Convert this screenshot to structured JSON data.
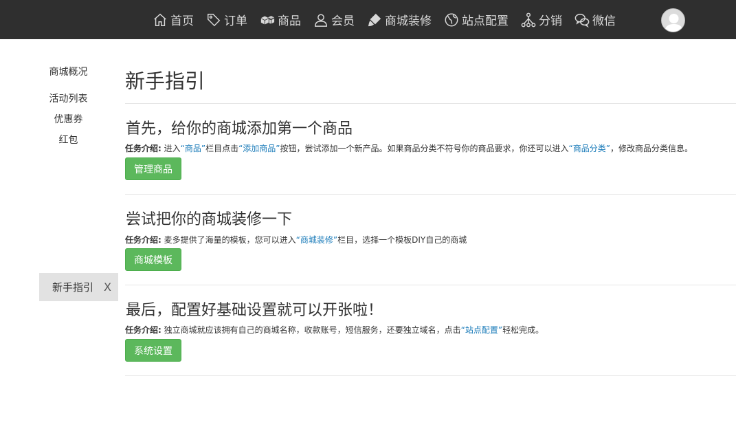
{
  "nav": {
    "items": [
      {
        "label": "首页",
        "icon": "home-icon"
      },
      {
        "label": "订单",
        "icon": "tag-icon"
      },
      {
        "label": "商品",
        "icon": "boxes-icon"
      },
      {
        "label": "会员",
        "icon": "user-icon"
      },
      {
        "label": "商城装修",
        "icon": "brush-icon"
      },
      {
        "label": "站点配置",
        "icon": "globe-icon"
      },
      {
        "label": "分销",
        "icon": "network-icon"
      },
      {
        "label": "微信",
        "icon": "wechat-icon"
      }
    ]
  },
  "sidebar": {
    "items": [
      "商城概况",
      "活动列表",
      "优惠券",
      "红包"
    ],
    "active_tab": {
      "label": "新手指引",
      "close": "X"
    }
  },
  "main": {
    "title": "新手指引",
    "steps": [
      {
        "title": "首先，给你的商城添加第一个商品",
        "desc_label": "任务介绍:",
        "desc_parts": [
          " 进入",
          "“商品”",
          "栏目点击",
          "“添加商品”",
          "按钮，尝试添加一个新产品。如果商品分类不符号你的商品要求，你还可以进入",
          "“商品分类”",
          "，修改商品分类信息。"
        ],
        "button": "管理商品"
      },
      {
        "title": "尝试把你的商城装修一下",
        "desc_label": "任务介绍:",
        "desc_parts": [
          " 麦多提供了海量的模板，您可以进入",
          "“商城装修”",
          "栏目，选择一个模板DIY自己的商城"
        ],
        "button": "商城模板"
      },
      {
        "title": "最后，配置好基础设置就可以开张啦！",
        "desc_label": "任务介绍:",
        "desc_parts": [
          " 独立商城就应该拥有自己的商城名称，收款账号，短信服务，还要独立域名，点击",
          "“站点配置”",
          "轻松完成。"
        ],
        "button": "系统设置"
      }
    ]
  },
  "colors": {
    "topbar": "#2f2f2f",
    "button": "#5cb85c",
    "link": "#1a7bb9"
  }
}
